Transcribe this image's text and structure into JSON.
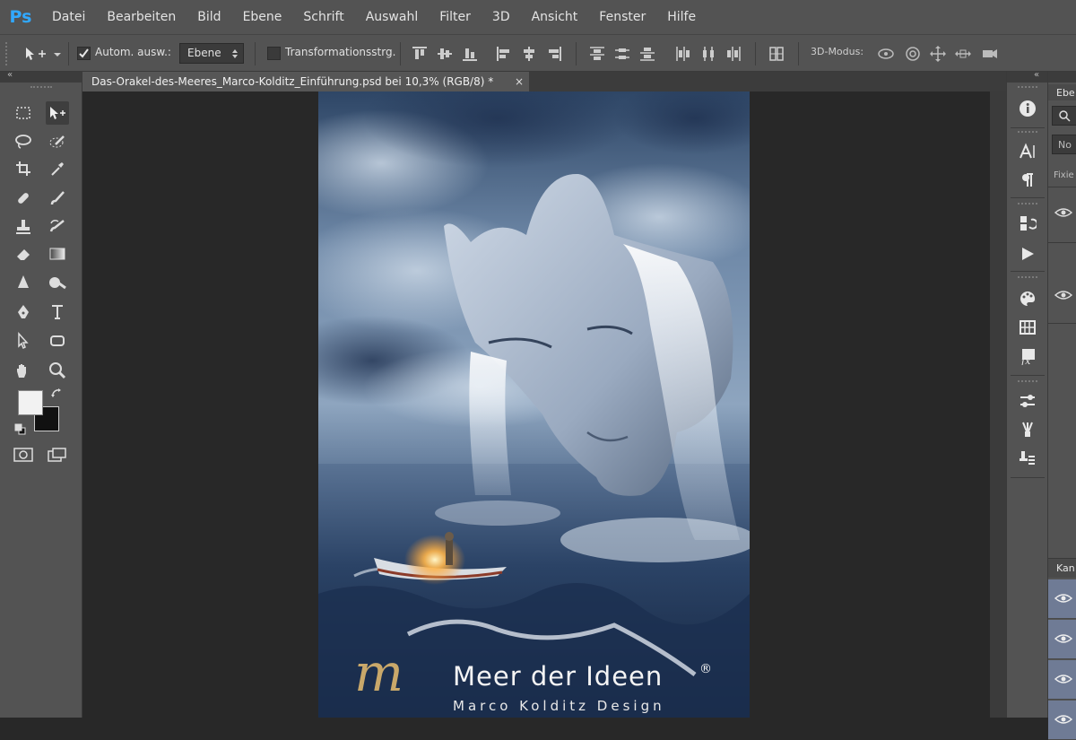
{
  "app": {
    "logo": "Ps"
  },
  "menu": [
    "Datei",
    "Bearbeiten",
    "Bild",
    "Ebene",
    "Schrift",
    "Auswahl",
    "Filter",
    "3D",
    "Ansicht",
    "Fenster",
    "Hilfe"
  ],
  "options": {
    "auto_select_label": "Autom. ausw.:",
    "auto_select_checked": true,
    "layer_select_value": "Ebene",
    "transform_label": "Transformationsstrg.",
    "mode_label": "3D-Modus:"
  },
  "document_tab": {
    "title": "Das-Orakel-des-Meeres_Marco-Kolditz_Einführung.psd bei 10,3% (RGB/8) *",
    "close": "×"
  },
  "artwork": {
    "brand_name": "Meer der Ideen",
    "brand_registered": "®",
    "brand_sub": "Marco Kolditz Design"
  },
  "right_panel": {
    "layers_tab": "Ebe",
    "mode_value": "No",
    "lock_label": "Fixie",
    "channels_tab": "Kan"
  },
  "colors": {
    "foreground": "#f2f2f2",
    "background": "#111111",
    "accent": "#31a8ff"
  }
}
